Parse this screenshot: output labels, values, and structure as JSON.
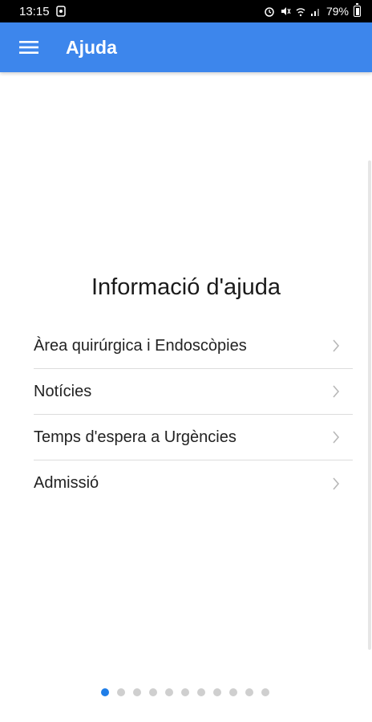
{
  "status_bar": {
    "time": "13:15",
    "battery_text": "79%"
  },
  "app_bar": {
    "title": "Ajuda",
    "menu_icon": "hamburger-menu-icon",
    "color": "#3d86ec"
  },
  "main": {
    "heading": "Informació d'ajuda",
    "items": [
      {
        "label": "Àrea quirúrgica i Endoscòpies"
      },
      {
        "label": "Notícies"
      },
      {
        "label": "Temps d'espera a Urgències"
      },
      {
        "label": "Admissió"
      }
    ]
  },
  "pager": {
    "total": 11,
    "active": 1,
    "active_color": "#1f7ee8"
  }
}
